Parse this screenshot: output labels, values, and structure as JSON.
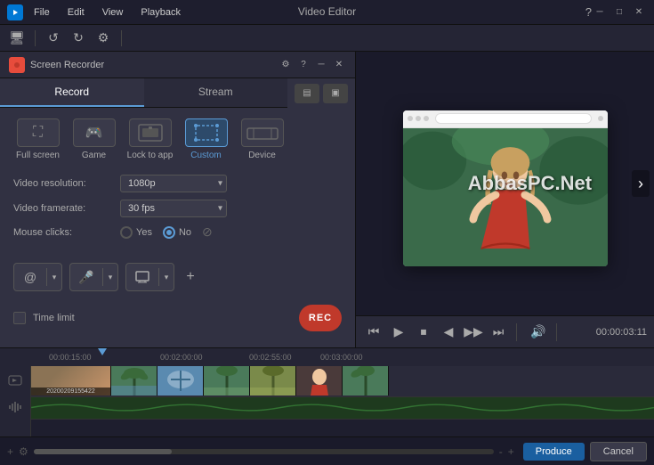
{
  "app": {
    "title": "Video Editor",
    "help_icon": "?",
    "minimize_icon": "─",
    "maximize_icon": "□",
    "close_icon": "✕"
  },
  "menu": {
    "items": [
      "File",
      "Edit",
      "View",
      "Playback"
    ]
  },
  "recorder": {
    "title": "Screen Recorder",
    "gear_icon": "⚙",
    "help_icon": "?",
    "minus_icon": "─",
    "close_icon": "✕",
    "tabs": [
      {
        "label": "Record",
        "active": true
      },
      {
        "label": "Stream",
        "active": false
      }
    ],
    "modes": [
      {
        "label": "Full screen",
        "icon": "⛶",
        "active": false
      },
      {
        "label": "Game",
        "icon": "🎮",
        "active": false
      },
      {
        "label": "Lock to app",
        "icon": "🔒",
        "active": false
      },
      {
        "label": "Custom",
        "icon": "⊞",
        "active": true
      },
      {
        "label": "Device",
        "icon": "▬",
        "active": false
      }
    ],
    "settings": {
      "video_resolution_label": "Video resolution:",
      "video_resolution_value": "1080p",
      "video_framerate_label": "Video framerate:",
      "video_framerate_value": "30 fps",
      "mouse_clicks_label": "Mouse clicks:",
      "mouse_yes": "Yes",
      "mouse_no": "No",
      "mouse_selected": "No"
    },
    "audio_icon": "@",
    "mic_icon": "🎤",
    "screen_icon": "⊡",
    "plus_icon": "+",
    "time_limit_label": "Time limit",
    "rec_label": "REC"
  },
  "playback": {
    "controls": [
      "⏮",
      "▶",
      "⏹",
      "◀",
      "▶▶",
      "⏭"
    ],
    "time": "00:00:03:11",
    "volume_icon": "🔊"
  },
  "timeline": {
    "ruler_marks": [
      "00:00:15:00",
      "00:02:00:00",
      "00:02:55:00",
      "00:03:00:00"
    ],
    "file_label": "20200209155422"
  },
  "watermark": "AbbasPC.Net",
  "bottom": {
    "produce_label": "Produce",
    "cancel_label": "Cancel"
  }
}
